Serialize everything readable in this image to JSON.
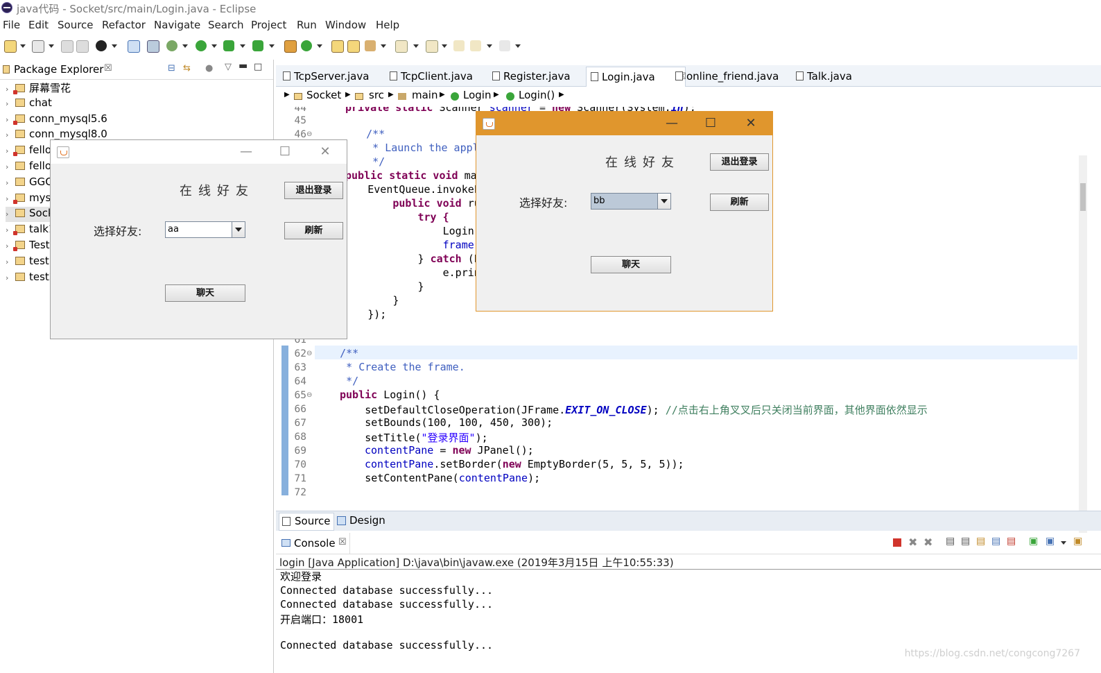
{
  "window": {
    "title": "java代码 - Socket/src/main/Login.java - Eclipse"
  },
  "menu": [
    "File",
    "Edit",
    "Source",
    "Refactor",
    "Navigate",
    "Search",
    "Project",
    "Run",
    "Window",
    "Help"
  ],
  "package_explorer": {
    "title": "Package Explorer",
    "projects": [
      {
        "name": "屏幕雪花",
        "error": true
      },
      {
        "name": "chat",
        "error": false
      },
      {
        "name": "conn_mysql5.6",
        "error": true
      },
      {
        "name": "conn_mysql8.0",
        "error": false
      },
      {
        "name": "fello",
        "error": true
      },
      {
        "name": "fello",
        "error": false
      },
      {
        "name": "GGC",
        "error": false
      },
      {
        "name": "mysq",
        "error": true
      },
      {
        "name": "Sock",
        "error": false
      },
      {
        "name": "talk1",
        "error": true
      },
      {
        "name": "Test",
        "error": true
      },
      {
        "name": "test",
        "error": false
      },
      {
        "name": "test2",
        "error": false
      }
    ]
  },
  "editor": {
    "tabs": [
      {
        "label": "TcpServer.java",
        "active": false
      },
      {
        "label": "TcpClient.java",
        "active": false
      },
      {
        "label": "Register.java",
        "active": false
      },
      {
        "label": "Login.java",
        "active": true
      },
      {
        "label": "online_friend.java",
        "active": false
      },
      {
        "label": "Talk.java",
        "active": false
      }
    ],
    "breadcrumb": [
      "Socket",
      "src",
      "main",
      "Login",
      "Login()"
    ],
    "line_numbers": [
      "44",
      "45",
      "46",
      "",
      "",
      "",
      "",
      "",
      "",
      "",
      "",
      "",
      "",
      "",
      "",
      "",
      "61",
      "62",
      "63",
      "64",
      "65",
      "66",
      "67",
      "68",
      "69",
      "70",
      "71",
      "72"
    ],
    "code": {
      "l44": "    private static Scanner scanner = new Scanner(System.in);",
      "l46": "    /**",
      "l47": "     * Launch the applicat",
      "l48": "     */",
      "l49a": "public static void ",
      "l49b": "mai",
      "l50": "        EventQueue.invokeL",
      "l51a": "            ",
      "l51b": "public void ",
      "l51c": "ru",
      "l52": "                try {",
      "l53": "                    Login",
      "l54": "                    frame.",
      "l55a": "                } ",
      "l55b": "catch",
      "l55c": " (E",
      "l56": "                    e.prin",
      "l57": "                }",
      "l58": "            }",
      "l59": "        });",
      "l62": "    /**",
      "l63": "     * Create the frame.",
      "l64": "     */",
      "l65a": "public",
      "l65b": " Login() {",
      "l66a": "        setDefaultCloseOperation(JFrame.",
      "l66b": "EXIT_ON_CLOSE",
      "l66c": "); ",
      "l66d": "//点击右上角叉叉后只关闭当前界面，其他界面依然显示",
      "l67": "        setBounds(100, 100, 450, 300);",
      "l68a": "        setTitle(",
      "l68b": "\"登录界面\"",
      "l68c": ");",
      "l69a": "contentPane",
      "l69b": " = ",
      "l69c": "new",
      "l69d": " JPanel();",
      "l70a": "contentPane",
      "l70b": ".setBorder(",
      "l70c": "new",
      "l70d": " EmptyBorder(5, 5, 5, 5));",
      "l71a": "        setContentPane(",
      "l71b": "contentPane",
      "l71c": ");"
    },
    "bottom_tabs": [
      "Source",
      "Design"
    ]
  },
  "console": {
    "title": "Console",
    "description": "login [Java Application] D:\\java\\bin\\javaw.exe (2019年3月15日 上午10:55:33)",
    "lines": [
      "欢迎登录",
      "Connected database successfully...",
      "Connected database successfully...",
      "开启端口：18001",
      "",
      "Connected database successfully..."
    ]
  },
  "friend_window_left": {
    "heading": "在线好友",
    "select_label": "选择好友:",
    "selected_friend": "aa",
    "logout_button": "退出登录",
    "refresh_button": "刷新",
    "chat_button": "聊天"
  },
  "friend_window_right": {
    "heading": "在线好友",
    "select_label": "选择好友:",
    "selected_friend": "bb",
    "logout_button": "退出登录",
    "refresh_button": "刷新",
    "chat_button": "聊天"
  },
  "watermark": "https://blog.csdn.net/congcong7267",
  "colors": {
    "active_window_title": "#e0962d",
    "keyword": "#7f0055",
    "comment": "#3f5fbf",
    "field": "#0000c0"
  }
}
